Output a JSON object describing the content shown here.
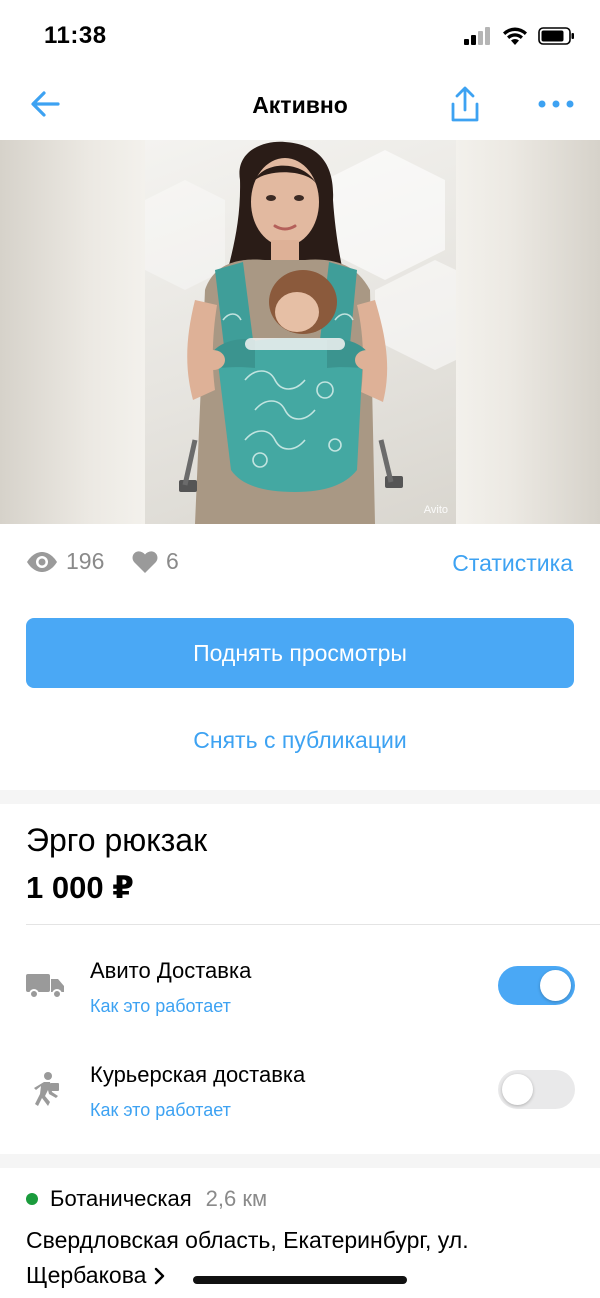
{
  "status_bar": {
    "time": "11:38"
  },
  "nav": {
    "title": "Активно",
    "back_icon": "arrow-left-icon",
    "share_icon": "share-icon",
    "more_icon": "more-dots-icon"
  },
  "photo": {
    "watermark": "Avito"
  },
  "stats": {
    "views": "196",
    "likes": "6",
    "stats_link": "Статистика"
  },
  "actions": {
    "raise_label": "Поднять просмотры",
    "unpublish_label": "Снять с публикации"
  },
  "item": {
    "title": "Эрго рюкзак",
    "price": "1 000 ₽"
  },
  "delivery": [
    {
      "label": "Авито Доставка",
      "link": "Как это работает",
      "enabled": true,
      "icon": "truck-icon"
    },
    {
      "label": "Курьерская доставка",
      "link": "Как это работает",
      "enabled": false,
      "icon": "walking-courier-icon"
    }
  ],
  "location": {
    "metro": "Ботаническая",
    "distance": "2,6 км",
    "address_line1": "Свердловская область, Екатеринбург, ул.",
    "address_line2": "Щербакова"
  },
  "colors": {
    "accent": "#4aa8f5",
    "link": "#3da2f2",
    "metro_green": "#1a9b3c",
    "muted": "#8a8a8a"
  }
}
